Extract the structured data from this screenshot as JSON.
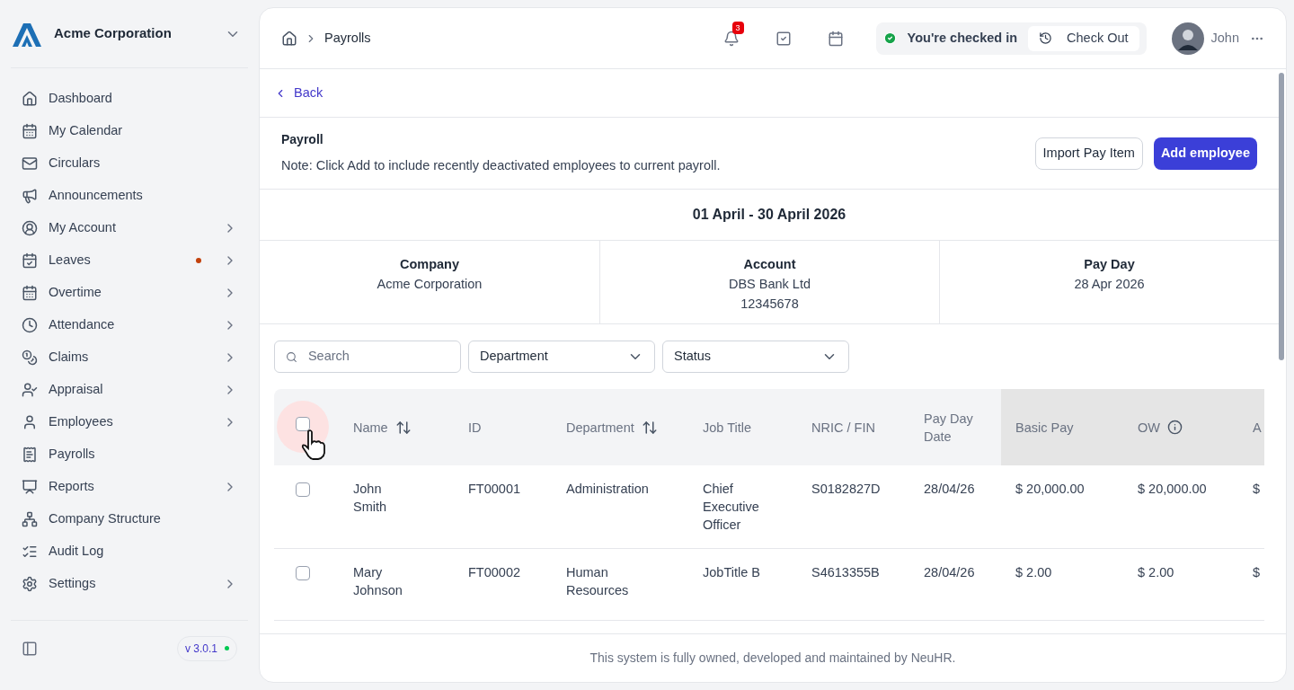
{
  "sidebar": {
    "company": "Acme Corporation",
    "items": [
      {
        "label": "Dashboard",
        "submenu": false,
        "dot": false
      },
      {
        "label": "My Calendar",
        "submenu": false,
        "dot": false
      },
      {
        "label": "Circulars",
        "submenu": false,
        "dot": false
      },
      {
        "label": "Announcements",
        "submenu": false,
        "dot": false
      },
      {
        "label": "My Account",
        "submenu": true,
        "dot": false
      },
      {
        "label": "Leaves",
        "submenu": true,
        "dot": true
      },
      {
        "label": "Overtime",
        "submenu": true,
        "dot": false
      },
      {
        "label": "Attendance",
        "submenu": true,
        "dot": false
      },
      {
        "label": "Claims",
        "submenu": true,
        "dot": false
      },
      {
        "label": "Appraisal",
        "submenu": true,
        "dot": false
      },
      {
        "label": "Employees",
        "submenu": true,
        "dot": false
      },
      {
        "label": "Payrolls",
        "submenu": false,
        "dot": false
      },
      {
        "label": "Reports",
        "submenu": true,
        "dot": false
      },
      {
        "label": "Company Structure",
        "submenu": false,
        "dot": false
      },
      {
        "label": "Audit Log",
        "submenu": false,
        "dot": false
      },
      {
        "label": "Settings",
        "submenu": true,
        "dot": false
      }
    ],
    "version": "v 3.0.1"
  },
  "header": {
    "breadcrumb": "Payrolls",
    "notifications": "3",
    "checkin_status": "You're checked in",
    "checkout_button": "Check Out",
    "user": "John"
  },
  "back": "Back",
  "payroll": {
    "title": "Payroll",
    "note": "Note: Click Add to include recently deactivated employees to current payroll.",
    "buttons": [
      {
        "label": "Import Pay Item",
        "kind": "secondary"
      },
      {
        "label": "Add employee",
        "kind": "primary"
      }
    ]
  },
  "period": "01 April - 30 April 2026",
  "info": [
    {
      "label": "Company",
      "lines": [
        "Acme Corporation"
      ]
    },
    {
      "label": "Account",
      "lines": [
        "DBS Bank Ltd",
        "12345678"
      ]
    },
    {
      "label": "Pay Day",
      "lines": [
        "28 Apr 2026"
      ]
    }
  ],
  "filters": {
    "search_placeholder": "Search",
    "dropdowns": [
      "Department",
      "Status"
    ]
  },
  "table": {
    "header_checked": false,
    "columns": [
      {
        "label": "Name",
        "sortable": true,
        "info": false,
        "shaded": false
      },
      {
        "label": "ID",
        "sortable": false,
        "info": false,
        "shaded": false
      },
      {
        "label": "Department",
        "sortable": true,
        "info": false,
        "shaded": false
      },
      {
        "label": "Job Title",
        "sortable": false,
        "info": false,
        "shaded": false
      },
      {
        "label": "NRIC / FIN",
        "sortable": false,
        "info": false,
        "shaded": false
      },
      {
        "label": "Pay Day Date",
        "sortable": false,
        "info": false,
        "shaded": false
      },
      {
        "label": "Basic Pay",
        "sortable": false,
        "info": false,
        "shaded": true
      },
      {
        "label": "OW",
        "sortable": false,
        "info": true,
        "shaded": true
      },
      {
        "label": "A",
        "sortable": false,
        "info": false,
        "shaded": true
      }
    ],
    "rows": [
      {
        "checked": false,
        "cells": [
          "John Smith",
          "FT00001",
          "Administration",
          "Chief Executive Officer",
          "S0182827D",
          "28/04/26",
          "$ 20,000.00",
          "$ 20,000.00",
          "$"
        ]
      },
      {
        "checked": false,
        "cells": [
          "Mary Johnson",
          "FT00002",
          "Human Resources",
          "JobTitle B",
          "S4613355B",
          "28/04/26",
          "$ 2.00",
          "$ 2.00",
          "$"
        ]
      }
    ]
  },
  "footer": "This system is fully owned, developed and maintained by NeuHR."
}
